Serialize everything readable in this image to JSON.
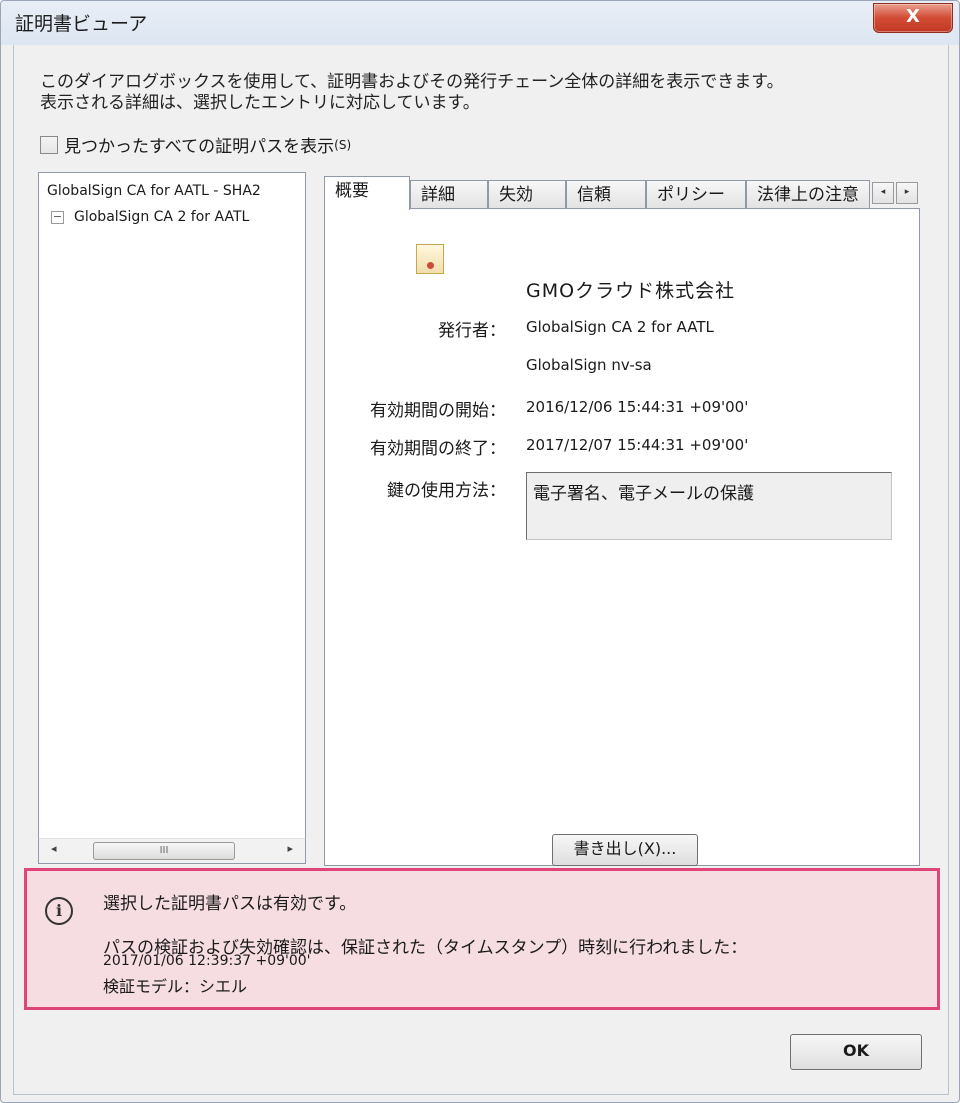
{
  "window": {
    "title": "証明書ビューア",
    "close_glyph": "X"
  },
  "description": {
    "line1": "このダイアログボックスを使用して、証明書およびその発行チェーン全体の詳細を表示できます。",
    "line2": "表示される詳細は、選択したエントリに対応しています。"
  },
  "show_all_paths": {
    "label": "見つかったすべての証明パスを表示",
    "accesskey": "(S)",
    "checked": false
  },
  "tree": {
    "root": "GlobalSign CA for AATL - SHA2",
    "child": "GlobalSign CA 2 for AATL",
    "child_expander": "−",
    "scroll_left": "◂",
    "scroll_right": "▸",
    "scroll_thumb": "III"
  },
  "tabs": [
    "概要",
    "詳細",
    "失効",
    "信頼",
    "ポリシー",
    "法律上の注意"
  ],
  "tab_scroll": {
    "left": "◂",
    "right": "▸"
  },
  "summary": {
    "subject": "GMOクラウド株式会社",
    "issuer_label": "発行者：",
    "issuer_value_1": "GlobalSign CA 2 for AATL",
    "issuer_value_2": "GlobalSign nv-sa",
    "valid_from_label": "有効期間の開始：",
    "valid_from_value": "2016/12/06 15:44:31 +09'00'",
    "valid_to_label": "有効期間の終了：",
    "valid_to_value": "2017/12/07 15:44:31 +09'00'",
    "key_usage_label": "鍵の使用方法：",
    "key_usage_value": "電子署名、電子メールの保護"
  },
  "export_button": "書き出し(X)...",
  "status": {
    "icon": "i",
    "title": "選択した証明書パスは有効です。",
    "detail_line1": "パスの検証および失効確認は、保証された（タイムスタンプ）時刻に行われました：",
    "detail_line2": "2017/01/06 12:39:37 +09'00'",
    "detail_line3": "検証モデル：シエル"
  },
  "ok_button": "OK"
}
